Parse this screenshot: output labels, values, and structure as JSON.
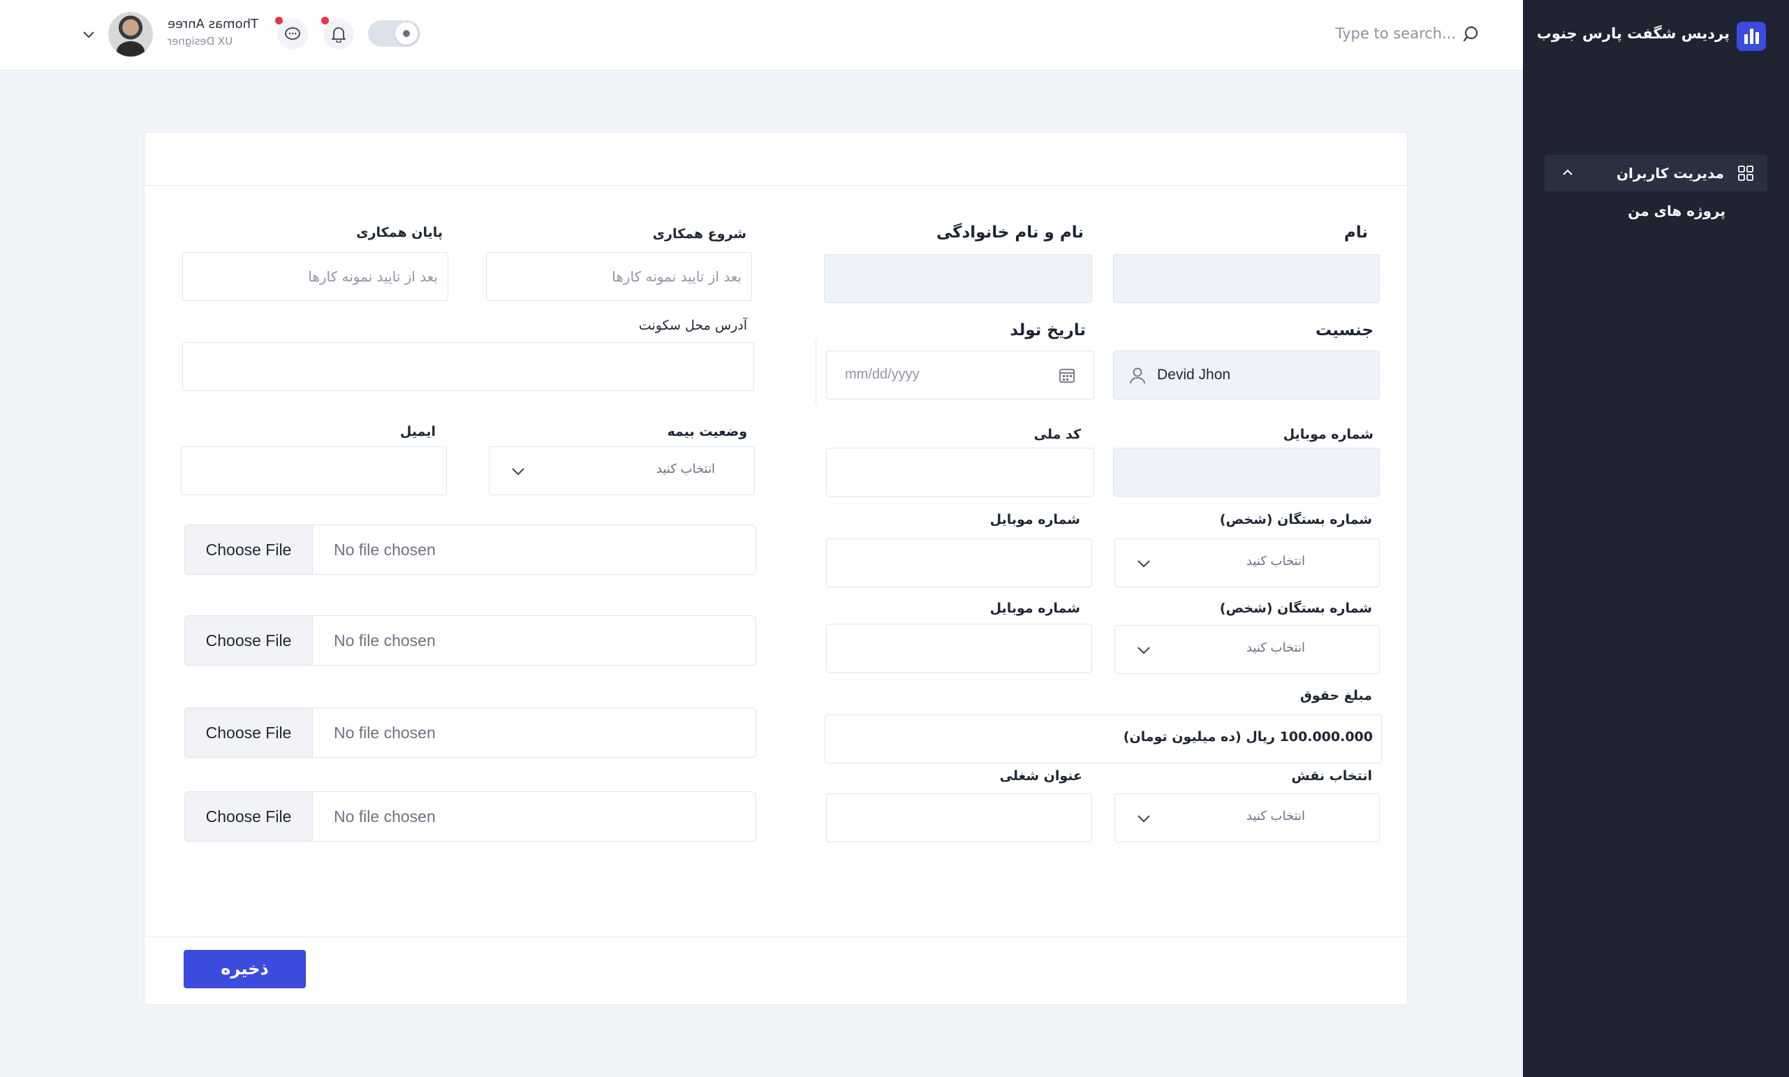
{
  "sidebar": {
    "brand": "پردیس شگفت پارس جنوب",
    "menu": {
      "users": "مدیریت کاربران",
      "projects": "پروژه های من"
    }
  },
  "header": {
    "search_placeholder": "Type to search...",
    "user_name": "Thomas Anree",
    "user_role": "UX Designer"
  },
  "form": {
    "first_name": {
      "label": "نام",
      "value": ""
    },
    "full_name": {
      "label": "نام و نام خانوادگی",
      "value": ""
    },
    "coop_start": {
      "label": "شروع همکاری",
      "placeholder": "بعد از تایید نمونه کارها"
    },
    "coop_end": {
      "label": "پایان همکاری",
      "placeholder": "بعد از تایید نمونه کارها"
    },
    "gender": {
      "label": "جنسیت",
      "value": "Devid Jhon"
    },
    "birth_date": {
      "label": "تاریخ تولد",
      "placeholder": "mm/dd/yyyy"
    },
    "address": {
      "label": "آدرس محل سکونت",
      "value": ""
    },
    "mobile": {
      "label": "شماره موبایل",
      "value": ""
    },
    "national_code": {
      "label": "کد ملی",
      "value": ""
    },
    "insurance": {
      "label": "وضعیت بیمه",
      "selected": "انتخاب کنید"
    },
    "email": {
      "label": "ایمیل",
      "value": ""
    },
    "relative_1": {
      "label": "شماره بستگان (شخص)",
      "selected": "انتخاب کنید"
    },
    "relative_1_mobile": {
      "label": "شماره موبایل",
      "value": ""
    },
    "relative_2": {
      "label": "شماره بستگان (شخص)",
      "selected": "انتخاب کنید"
    },
    "relative_2_mobile": {
      "label": "شماره موبایل",
      "value": ""
    },
    "salary": {
      "label": "مبلغ حقوق",
      "value": "100.000.000 ریال (ده میلیون تومان)"
    },
    "role": {
      "label": "انتخاب نقش",
      "selected": "انتخاب کنید"
    },
    "job_title": {
      "label": "عنوان شغلی",
      "value": ""
    },
    "files": [
      {
        "button": "Choose File",
        "status": "No file chosen"
      },
      {
        "button": "Choose File",
        "status": "No file chosen"
      },
      {
        "button": "Choose File",
        "status": "No file chosen"
      },
      {
        "button": "Choose File",
        "status": "No file chosen"
      }
    ],
    "save_label": "ذخیره"
  },
  "colors": {
    "accent": "#3b4bde",
    "sidebar_bg": "#1f2332",
    "notification_dot": "#e8334a"
  }
}
